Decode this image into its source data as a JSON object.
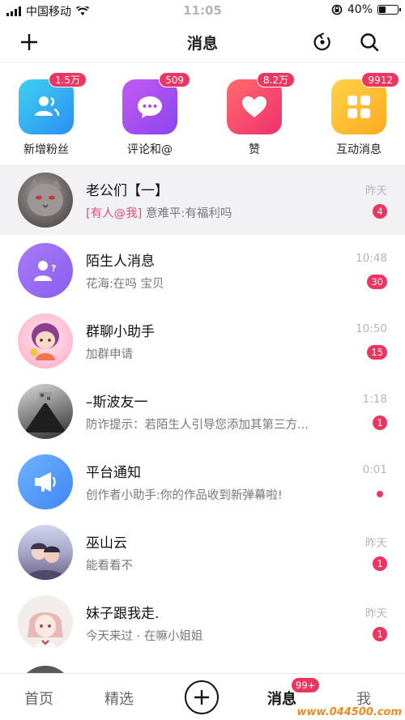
{
  "status_bar": {
    "carrier": "中国移动",
    "time": "11:05",
    "battery": "40%",
    "battery_level": 0.4
  },
  "navbar": {
    "title": "消息",
    "add_icon": "plus-icon",
    "refresh_icon": "refresh-icon",
    "search_icon": "search-icon"
  },
  "quick": [
    {
      "label": "新增粉丝",
      "badge": "1.5万",
      "icon": "fans-icon",
      "colors": [
        "#3fd1f0",
        "#2c8ef5"
      ]
    },
    {
      "label": "评论和@",
      "badge": "509",
      "icon": "comment-icon",
      "colors": [
        "#c35bf2",
        "#8a45f0"
      ]
    },
    {
      "label": "赞",
      "badge": "8.2万",
      "icon": "heart-icon",
      "colors": [
        "#ff6b6b",
        "#f0306f"
      ]
    },
    {
      "label": "互动消息",
      "badge": "9912",
      "icon": "grid-icon",
      "colors": [
        "#ffd34a",
        "#ffaa1e"
      ]
    }
  ],
  "messages": [
    {
      "name": "老公们【一】",
      "mention": "[有人@我]",
      "preview": " 意难平:有福利吗",
      "time": "昨天",
      "badge": "4"
    },
    {
      "name": "陌生人消息",
      "mention": "",
      "preview": "花海:在吗 宝贝",
      "time": "10:48",
      "badge": "30"
    },
    {
      "name": "群聊小助手",
      "mention": "",
      "preview": "加群申请",
      "time": "10:50",
      "badge": "15"
    },
    {
      "name": "–斯波友一",
      "mention": "",
      "preview": "防诈提示：若陌生人引导您添加其第三方...",
      "time": "1:18",
      "badge": "1"
    },
    {
      "name": "平台通知",
      "mention": "",
      "preview": "创作者小助手:你的作品收到新弹幕啦!",
      "time": "0:01",
      "badge": ""
    },
    {
      "name": "巫山云",
      "mention": "",
      "preview": "能看看不",
      "time": "昨天",
      "badge": "1"
    },
    {
      "name": "妹子跟我走.",
      "mention": "",
      "preview": "今天来过 · 在嘛小姐姐",
      "time": "昨天",
      "badge": "1"
    }
  ],
  "tabbar": {
    "home": "首页",
    "featured": "精选",
    "messages": "消息",
    "messages_badge": "99+",
    "me": "我",
    "watermark": "www.044500.com"
  },
  "colors": {
    "accent": "#ee3560",
    "mention": "#e84a78"
  }
}
